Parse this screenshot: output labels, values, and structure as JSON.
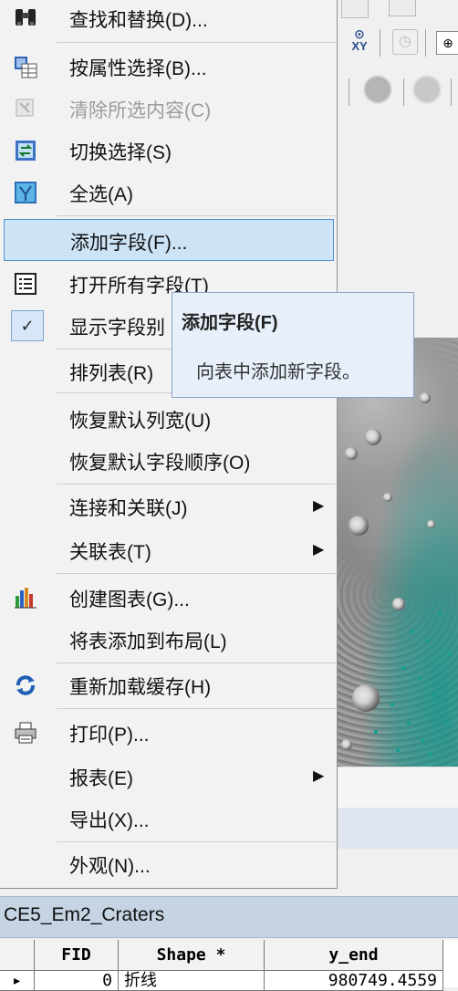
{
  "menu": {
    "items": [
      {
        "label": "查找和替换(D)...",
        "icon": "binoculars-icon"
      },
      {
        "label": "按属性选择(B)...",
        "icon": "select-by-attributes-icon"
      },
      {
        "label": "清除所选内容(C)",
        "icon": "clear-selection-icon",
        "disabled": true
      },
      {
        "label": "切换选择(S)",
        "icon": "switch-selection-icon"
      },
      {
        "label": "全选(A)",
        "icon": "select-all-icon"
      },
      {
        "label": "添加字段(F)...",
        "highlighted": true
      },
      {
        "label": "打开所有字段(T)",
        "icon": "list-icon"
      },
      {
        "label": "显示字段别",
        "icon": "checkbox-checked-icon"
      },
      {
        "label": "排列表(R)"
      },
      {
        "label": "恢复默认列宽(U)"
      },
      {
        "label": "恢复默认字段顺序(O)"
      },
      {
        "label": "连接和关联(J)",
        "submenu": true
      },
      {
        "label": "关联表(T)",
        "submenu": true
      },
      {
        "label": "创建图表(G)...",
        "icon": "bar-chart-icon"
      },
      {
        "label": "将表添加到布局(L)"
      },
      {
        "label": "重新加载缓存(H)",
        "icon": "refresh-icon"
      },
      {
        "label": "打印(P)...",
        "icon": "printer-icon"
      },
      {
        "label": "报表(E)",
        "submenu": true
      },
      {
        "label": "导出(X)..."
      },
      {
        "label": "外观(N)..."
      }
    ],
    "submenu_arrow": "▶"
  },
  "tooltip": {
    "title": "添加字段(F)",
    "description": "向表中添加新字段。"
  },
  "table": {
    "title": "CE5_Em2_Craters",
    "columns": [
      "FID",
      "Shape *",
      "y_end"
    ],
    "row": {
      "marker": "▸",
      "fid": "0",
      "shape": "折线",
      "y_end": "980749.4559"
    }
  },
  "toolbar": {
    "xy_label": "XY"
  },
  "colors": {
    "menu_bg": "#f2f2f2",
    "highlight_bg": "#cde3f6",
    "highlight_border": "#4d93d4",
    "tooltip_bg": "#e7effa",
    "table_title_bg": "#c5d3e3"
  }
}
